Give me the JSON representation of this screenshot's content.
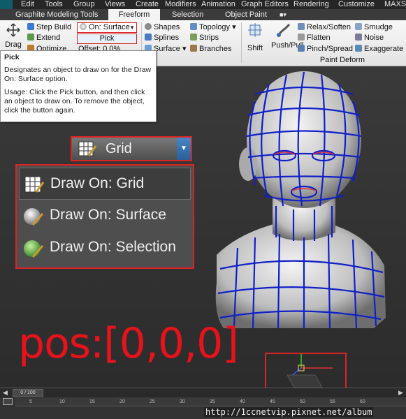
{
  "menubar": {
    "items": [
      "Edit",
      "Tools",
      "Group",
      "Views",
      "Create",
      "Modifiers",
      "Animation",
      "Graph Editors",
      "Rendering",
      "Customize",
      "MAXS"
    ]
  },
  "ribbon_tabs": {
    "items": [
      "Graphite Modeling Tools",
      "Freeform",
      "Selection",
      "Object Paint"
    ],
    "active": "Freeform",
    "extra_icon": "display-dropdown-icon"
  },
  "ribbon": {
    "drag_label": "Drag",
    "step_build_label": "Step Build",
    "extend_label": "Extend",
    "optimize_label": "Optimize",
    "offset_label": "Offset: 0.0%",
    "on_surface_label": "On: Surface",
    "pick_label": "Pick",
    "shapes_label": "Shapes",
    "splines_label": "Splines",
    "surface_label": "Surface",
    "topology_label": "Topology",
    "strips_label": "Strips",
    "branches_label": "Branches",
    "shift_label": "Shift",
    "push_pull_label": "Push/Pull",
    "relax_soften_label": "Relax/Soften",
    "flatten_label": "Flatten",
    "pinch_spread_label": "Pinch/Spread",
    "smudge_label": "Smudge",
    "noise_label": "Noise",
    "exaggerate_label": "Exaggerate",
    "paint_deform_label": "Paint Deform"
  },
  "tooltip": {
    "title": "Pick",
    "description": "Designates an object to draw on for the Draw On: Surface option.",
    "usage": "Usage: Click the Pick button, and then click an object to draw on. To remove the object, click the button again."
  },
  "draw_on_dropdown": {
    "current": "Grid",
    "options": [
      "Draw On: Grid",
      "Draw On: Surface",
      "Draw On: Selection"
    ]
  },
  "annotation": {
    "pos_text": "pos:[0,0,0]"
  },
  "timeline": {
    "frame_indicator": "0 / 100",
    "ticks": [
      "5",
      "10",
      "15",
      "20",
      "25",
      "30",
      "35",
      "40",
      "45",
      "50",
      "55",
      "60"
    ]
  },
  "watermark": "http://1ccnetvip.pixnet.net/album",
  "colors": {
    "accent_red": "#e8121b",
    "wire_blue": "#1020c8",
    "selection_blue": "#2a5f9a"
  }
}
